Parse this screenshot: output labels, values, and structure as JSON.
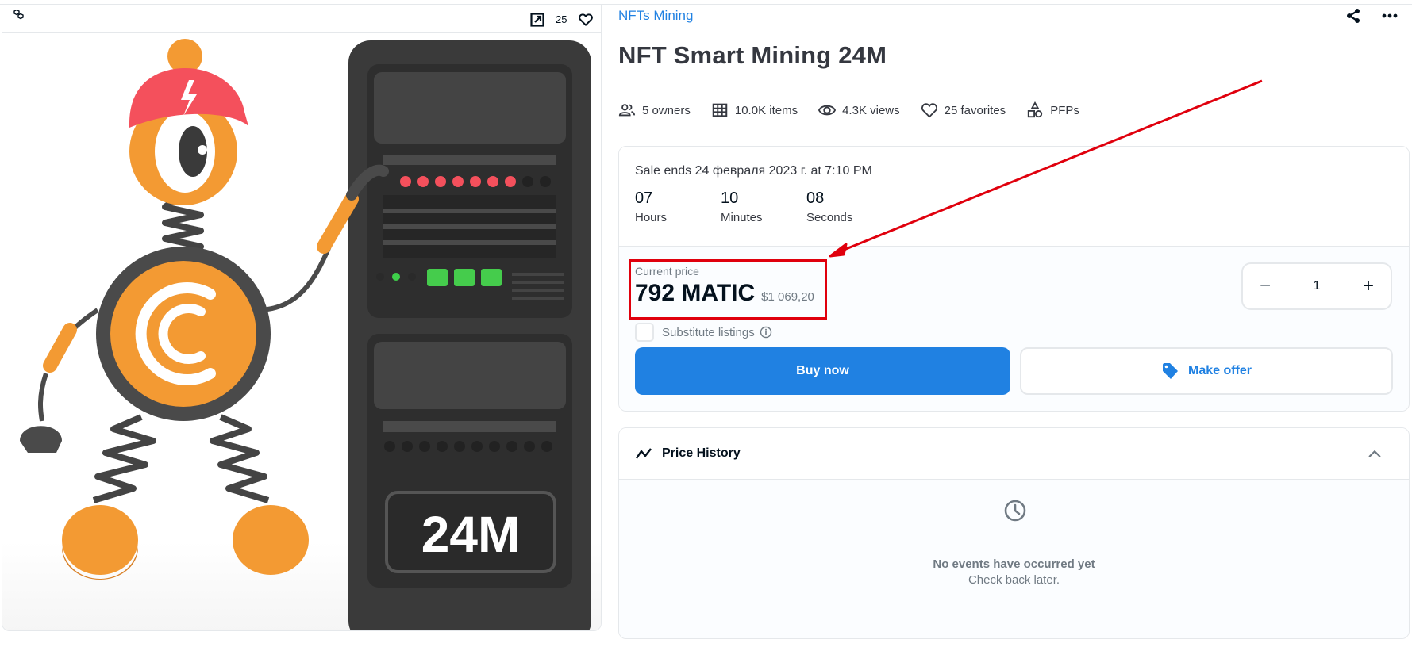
{
  "media": {
    "chain_icon": "polygon-chain-icon",
    "favorites_count": "25",
    "artwork": {
      "description": "Orange cartoon robot with red cap leaning on a dark server rack",
      "rack_label": "24M",
      "coin_letter": "C"
    }
  },
  "header": {
    "collection_link": "NFTs Mining",
    "title": "NFT Smart Mining 24M"
  },
  "stats": [
    {
      "icon": "owners-icon",
      "label": "5 owners"
    },
    {
      "icon": "grid-icon",
      "label": "10.0K items"
    },
    {
      "icon": "eye-icon",
      "label": "4.3K views"
    },
    {
      "icon": "heart-icon",
      "label": "25 favorites"
    },
    {
      "icon": "shapes-icon",
      "label": "PFPs"
    }
  ],
  "sale": {
    "ends_text": "Sale ends 24 февраля 2023 г. at 7:10 PM",
    "countdown": [
      {
        "value": "07",
        "label": "Hours"
      },
      {
        "value": "10",
        "label": "Minutes"
      },
      {
        "value": "08",
        "label": "Seconds"
      }
    ],
    "current_price_label": "Current price",
    "price": "792 MATIC",
    "price_usd": "$1 069,20",
    "substitute_label": "Substitute listings",
    "quantity": {
      "minus": "−",
      "value": "1",
      "plus": "+"
    },
    "buy_label": "Buy now",
    "offer_label": "Make offer"
  },
  "price_history": {
    "title": "Price History",
    "empty_title": "No events have occurred yet",
    "empty_subtitle": "Check back later."
  },
  "colors": {
    "accent": "#2081e2",
    "annotation": "#e0000d"
  }
}
